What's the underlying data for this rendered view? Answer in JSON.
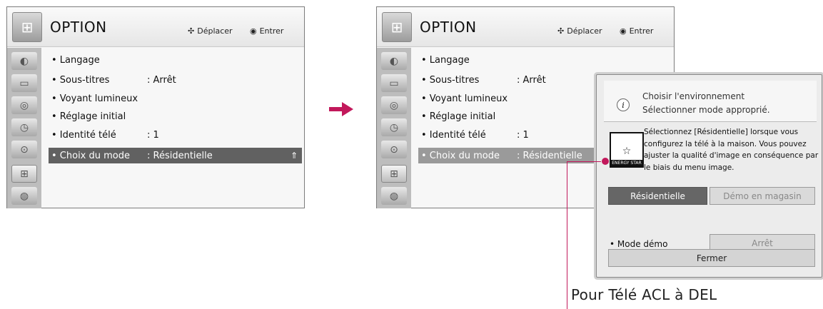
{
  "menu": {
    "title": "OPTION",
    "hint_move": "Déplacer",
    "hint_enter": "Entrer",
    "items": [
      {
        "name": "• Langage",
        "value": ""
      },
      {
        "name": "• Sous-titres",
        "value": ": Arrêt"
      },
      {
        "name": "• Voyant lumineux",
        "value": ""
      },
      {
        "name": "• Réglage initial",
        "value": ""
      },
      {
        "name": "• Identité télé",
        "value": ": 1"
      },
      {
        "name": "• Choix du mode",
        "value": ": Résidentielle"
      }
    ],
    "sidebar_icons": [
      "picture-icon",
      "screen-icon",
      "speaker-icon",
      "clock-icon",
      "lock-icon",
      "option-icon",
      "globe-icon"
    ]
  },
  "dialog": {
    "title_line1": "Choisir l'environnement",
    "title_line2": "Sélectionner mode approprié.",
    "body_lines": [
      "Sélectionnez [Résidentielle] lorsque vous",
      "configurez la télé à la maison. Vous pouvez",
      "ajuster la qualité d'image en conséquence par",
      "le biais du menu image."
    ],
    "logo_text": "ENERGY STAR",
    "btn_home": "Résidentielle",
    "btn_store": "Démo en magasin",
    "demo_label": "• Mode démo",
    "demo_value": "Arrêt",
    "close": "Fermer"
  },
  "caption": "Pour Télé ACL à DEL",
  "colors": {
    "accent": "#c2185b",
    "selected_row": "#616161"
  }
}
